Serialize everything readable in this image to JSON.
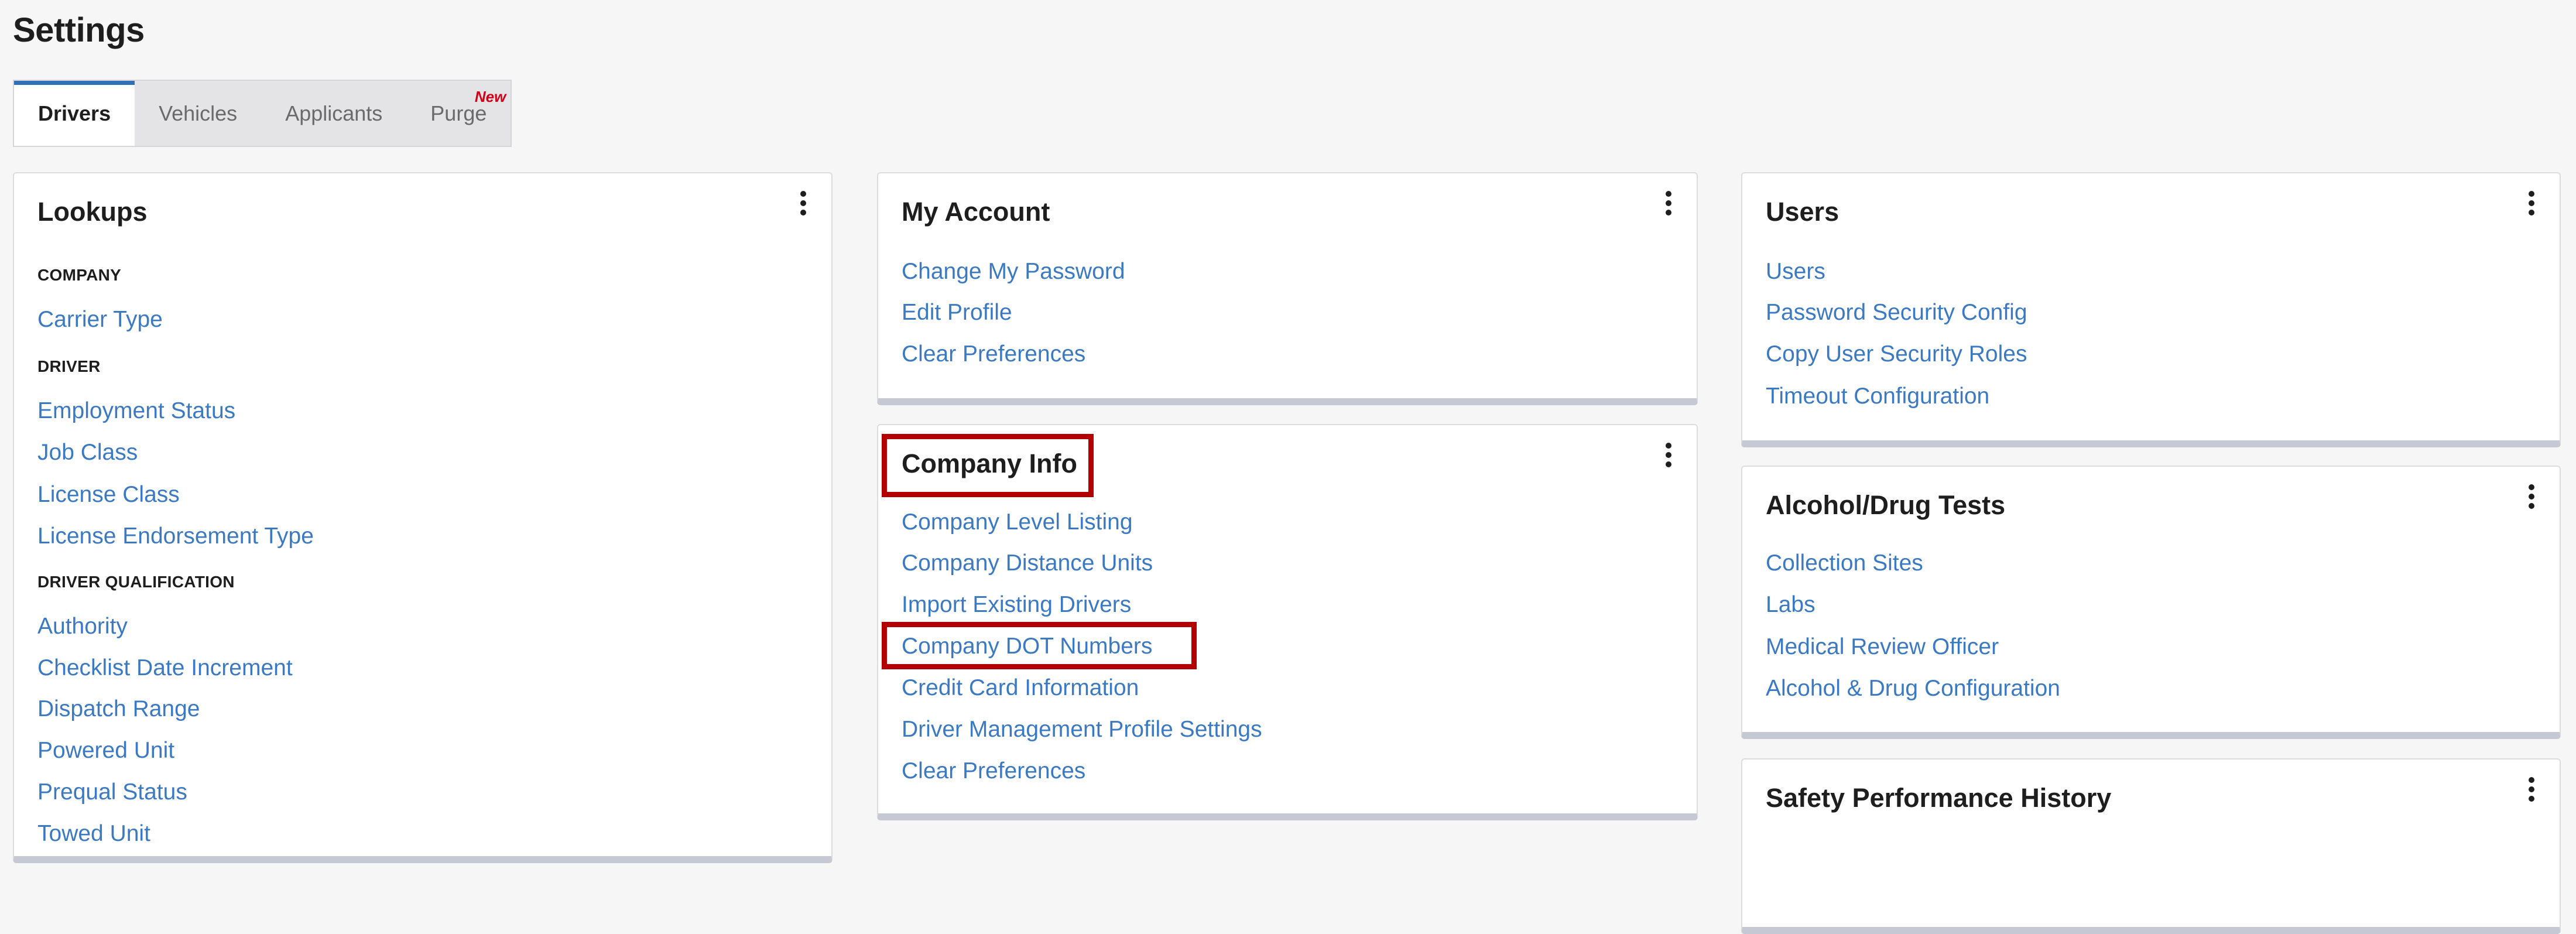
{
  "page": {
    "title": "Settings"
  },
  "tabs": [
    {
      "label": "Drivers",
      "active": true
    },
    {
      "label": "Vehicles",
      "active": false
    },
    {
      "label": "Applicants",
      "active": false
    },
    {
      "label": "Purge",
      "active": false,
      "badge": "New"
    }
  ],
  "lookups": {
    "title": "Lookups",
    "sections": [
      {
        "heading": "COMPANY",
        "items": [
          "Carrier Type"
        ]
      },
      {
        "heading": "DRIVER",
        "items": [
          "Employment Status",
          "Job Class",
          "License Class",
          "License Endorsement Type"
        ]
      },
      {
        "heading": "DRIVER QUALIFICATION",
        "items": [
          "Authority",
          "Checklist Date Increment",
          "Dispatch Range",
          "Powered Unit",
          "Prequal Status",
          "Towed Unit"
        ]
      }
    ]
  },
  "my_account": {
    "title": "My Account",
    "items": [
      "Change My Password",
      "Edit Profile",
      "Clear Preferences"
    ]
  },
  "company_info": {
    "title": "Company Info",
    "items": [
      "Company Level Listing",
      "Company Distance Units",
      "Import Existing Drivers",
      "Company DOT Numbers",
      "Credit Card Information",
      "Driver Management Profile Settings",
      "Clear Preferences"
    ]
  },
  "users": {
    "title": "Users",
    "items": [
      "Users",
      "Password Security Config",
      "Copy User Security Roles",
      "Timeout Configuration"
    ]
  },
  "alcohol_drug_tests": {
    "title": "Alcohol/Drug Tests",
    "items": [
      "Collection Sites",
      "Labs",
      "Medical Review Officer",
      "Alcohol & Drug Configuration"
    ]
  },
  "safety_performance_history": {
    "title": "Safety Performance History"
  },
  "colors": {
    "link": "#3b7ac3",
    "active_tab_accent": "#2f6fb8",
    "highlight": "#b30000",
    "badge": "#d0021b"
  }
}
